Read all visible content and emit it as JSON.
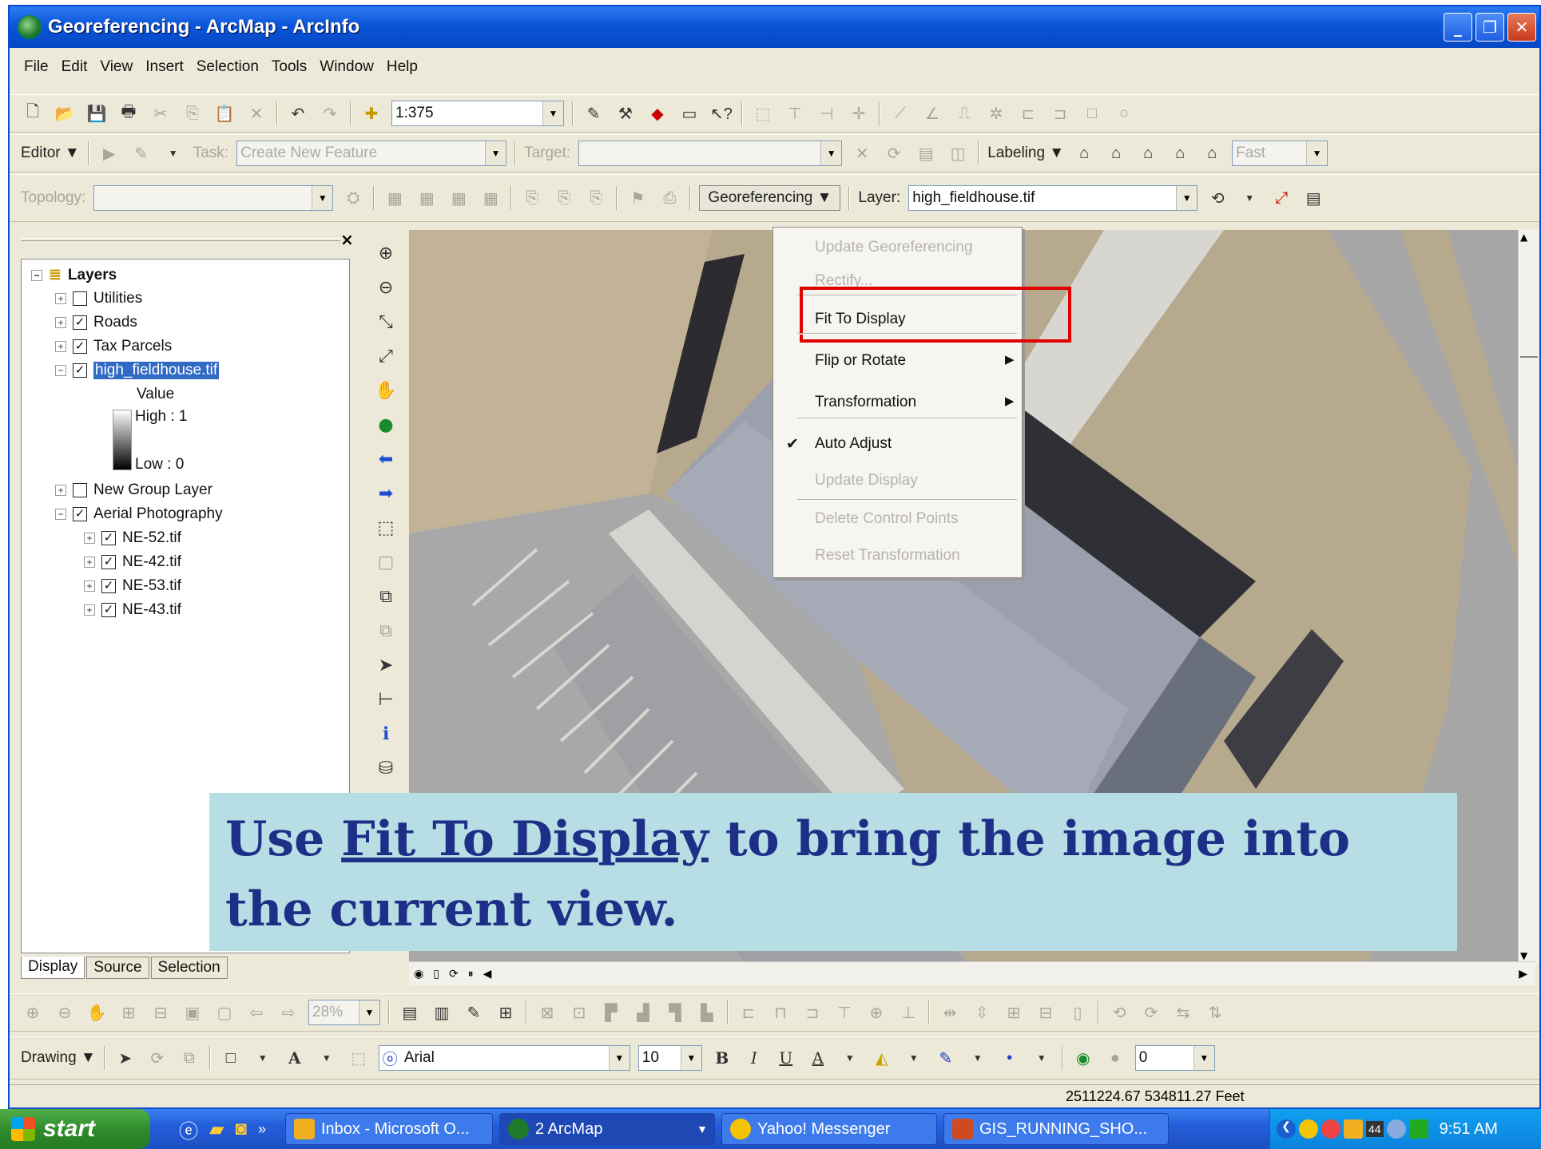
{
  "window": {
    "title": "Georeferencing - ArcMap - ArcInfo",
    "buttons": {
      "minimize": "_",
      "maximize": "❐",
      "close": "✕"
    }
  },
  "menubar": [
    "File",
    "Edit",
    "View",
    "Insert",
    "Selection",
    "Tools",
    "Window",
    "Help"
  ],
  "standard_toolbar": {
    "scale": "1:375"
  },
  "editor_toolbar": {
    "editor_label": "Editor",
    "task_label": "Task:",
    "task_value": "Create New Feature",
    "target_label": "Target:",
    "target_value": "",
    "labeling_label": "Labeling",
    "quality_value": "Fast"
  },
  "georef_toolbar": {
    "topology_label": "Topology:",
    "topology_value": "",
    "georef_menu_label": "Georeferencing",
    "layer_label": "Layer:",
    "layer_value": "high_fieldhouse.tif"
  },
  "georef_menu": {
    "items": [
      {
        "label": "Update Georeferencing",
        "enabled": false
      },
      {
        "label": "Rectify...",
        "enabled": false
      },
      {
        "label": "Fit To Display",
        "enabled": true,
        "highlighted": true
      },
      {
        "label": "Flip or Rotate",
        "enabled": true,
        "submenu": true
      },
      {
        "label": "Transformation",
        "enabled": true,
        "submenu": true
      },
      {
        "label": "Auto Adjust",
        "enabled": true,
        "checked": true
      },
      {
        "label": "Update Display",
        "enabled": false
      },
      {
        "label": "Delete Control Points",
        "enabled": false
      },
      {
        "label": "Reset Transformation",
        "enabled": false
      }
    ]
  },
  "toc": {
    "root": "Layers",
    "layers": [
      {
        "name": "Utilities",
        "checked": false
      },
      {
        "name": "Roads",
        "checked": true
      },
      {
        "name": "Tax Parcels",
        "checked": true
      },
      {
        "name": "high_fieldhouse.tif",
        "checked": true,
        "selected": true
      },
      {
        "name": "New Group Layer",
        "checked": false
      },
      {
        "name": "Aerial Photography",
        "checked": true
      }
    ],
    "legend": {
      "title": "Value",
      "high": "High : 1",
      "low": "Low : 0"
    },
    "sublayers": [
      "NE-52.tif",
      "NE-42.tif",
      "NE-53.tif",
      "NE-43.tif"
    ],
    "tabs": [
      "Display",
      "Source",
      "Selection"
    ]
  },
  "caption": {
    "part1": "Use ",
    "link": "Fit To Display",
    "part2": " to bring the image into the current view."
  },
  "drawing_toolbar": {
    "drawing_label": "Drawing",
    "font_name": "Arial",
    "font_size": "10",
    "bold": "B",
    "italic": "I",
    "underline": "U",
    "line_width": "0",
    "zoom_value": "28%"
  },
  "status": {
    "coords": "2511224.67  534811.27 Feet"
  },
  "taskbar": {
    "start_label": "start",
    "tasks": [
      "Inbox - Microsoft O...",
      "2 ArcMap",
      "Yahoo! Messenger",
      "GIS_RUNNING_SHO..."
    ],
    "tray_badge": "44",
    "clock": "9:51 AM"
  },
  "colors": {
    "highlight_box": "#e00000",
    "caption_bg": "#b7dee4",
    "caption_text": "#1e2f88",
    "title_bar": "#0a55d8"
  }
}
